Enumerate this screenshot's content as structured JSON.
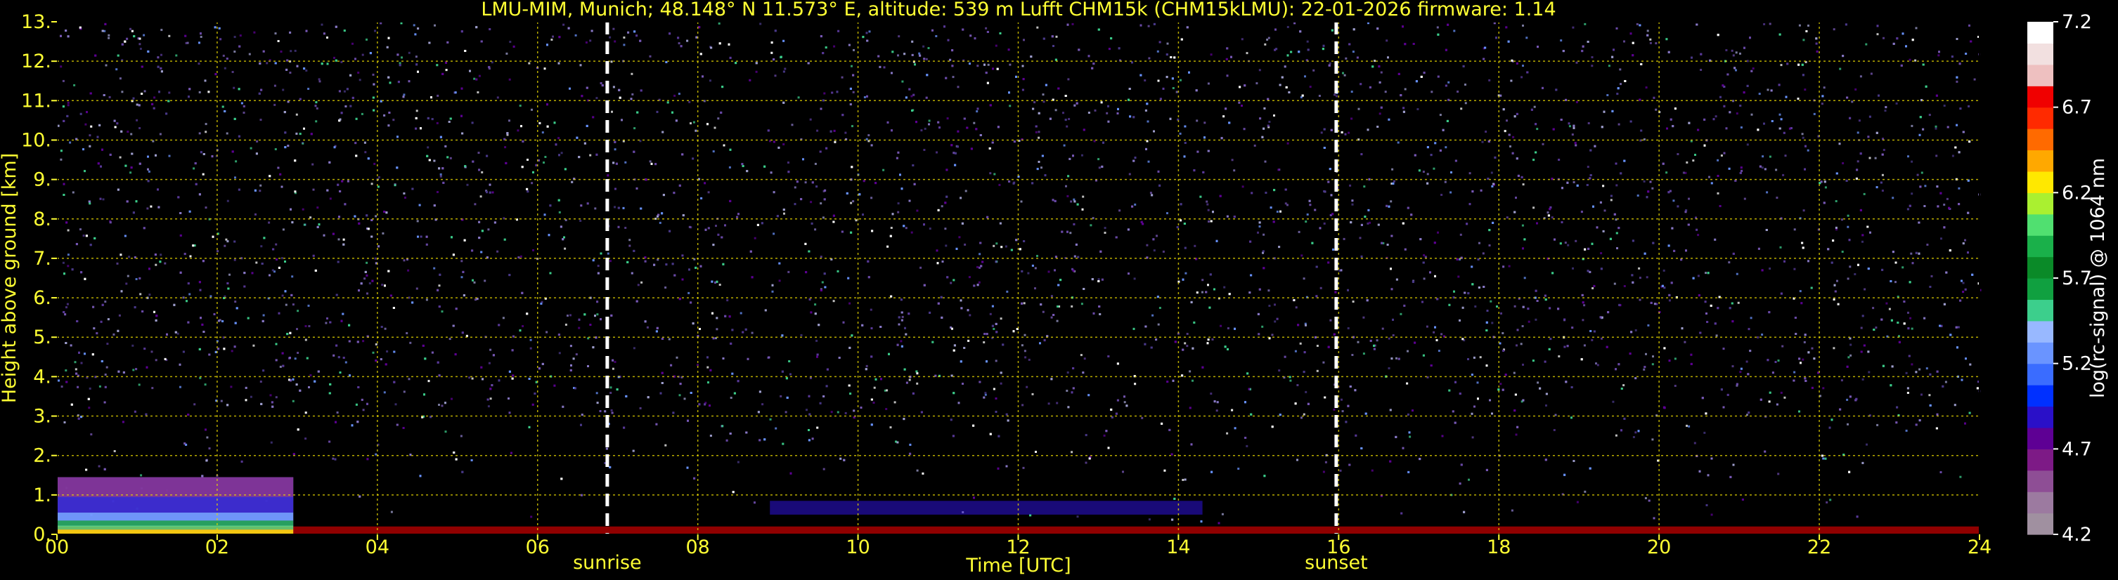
{
  "chart_data": {
    "type": "heatmap",
    "title": "LMU-MIM, Munich; 48.148° N 11.573° E, altitude: 539 m    Lufft CHM15k (CHM15kLMU): 22-01-2026    firmware: 1.14",
    "xlabel": "Time [UTC]",
    "ylabel": "Height above ground [km]",
    "xlim": [
      0,
      24
    ],
    "ylim": [
      0,
      13
    ],
    "x_ticks": [
      "00",
      "02",
      "04",
      "06",
      "08",
      "10",
      "12",
      "14",
      "16",
      "18",
      "20",
      "22",
      "24"
    ],
    "x_tick_values": [
      0,
      2,
      4,
      6,
      8,
      10,
      12,
      14,
      16,
      18,
      20,
      22,
      24
    ],
    "y_ticks": [
      "0.",
      "1.",
      "2.",
      "3.",
      "4.",
      "5.",
      "6.",
      "7.",
      "8.",
      "9.",
      "10.",
      "11.",
      "12.",
      "13."
    ],
    "y_tick_values": [
      0,
      1,
      2,
      3,
      4,
      5,
      6,
      7,
      8,
      9,
      10,
      11,
      12,
      13
    ],
    "grid": true,
    "annotations": [
      {
        "text": "sunrise",
        "x": 6.87
      },
      {
        "text": "sunset",
        "x": 15.97
      }
    ],
    "regions": [
      {
        "x": [
          0,
          2.95
        ],
        "y": [
          0,
          1.45
        ],
        "signal": 5.4
      },
      {
        "x": [
          8.9,
          14.3
        ],
        "y": [
          0.5,
          0.85
        ],
        "signal": 4.9
      },
      {
        "x": [
          0,
          24
        ],
        "y": [
          0,
          0.2
        ],
        "signal": 6.8
      }
    ],
    "colorbar": {
      "label": "log(rc-signal) @ 1064 nm",
      "min": 4.2,
      "max": 7.2,
      "ticks": [
        "4.2",
        "4.7",
        "5.2",
        "5.7",
        "6.2",
        "6.7",
        "7.2"
      ],
      "tick_values": [
        4.2,
        4.7,
        5.2,
        5.7,
        6.2,
        6.7,
        7.2
      ]
    },
    "colors": {
      "text": "#ffff33",
      "grid": "#e6d600",
      "background": "#000000",
      "marker": "#ffffff",
      "colorbar_stops": [
        "#a090a0",
        "#9c7aa0",
        "#8e4e95",
        "#7d1a86",
        "#5e0094",
        "#2a10c8",
        "#0030ff",
        "#3a6cff",
        "#6a94ff",
        "#98b8ff",
        "#3ccf8c",
        "#10a040",
        "#0a8a28",
        "#1ab04a",
        "#50e070",
        "#aaf030",
        "#ffe800",
        "#ffa800",
        "#ff6a00",
        "#ff2a00",
        "#f00000",
        "#eec0c0",
        "#f2e0e0",
        "#ffffff"
      ]
    }
  }
}
